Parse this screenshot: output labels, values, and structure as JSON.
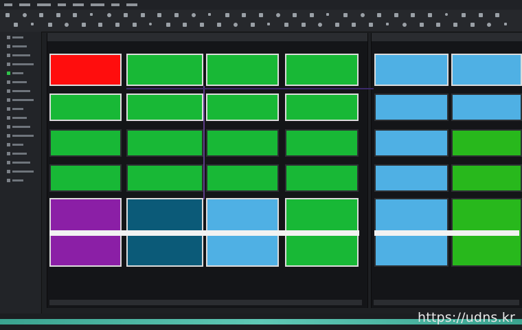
{
  "menu": {
    "items": [
      "",
      "",
      "",
      "",
      "",
      "",
      "",
      ""
    ]
  },
  "sidebar": {
    "items": [
      "",
      "",
      "",
      "",
      "",
      "",
      "",
      "",
      "",
      "",
      "",
      "",
      "",
      "",
      "",
      "",
      ""
    ]
  },
  "grid_colors": {
    "left": [
      [
        "#ff0d0d",
        "#18b836",
        "#18b836",
        "#18b836"
      ],
      [
        "#18b836",
        "#18b836",
        "#18b836",
        "#18b836"
      ],
      [
        "#18b836",
        "#18b836",
        "#18b836",
        "#18b836"
      ],
      [
        "#18b836",
        "#18b836",
        "#18b836",
        "#18b836"
      ],
      [
        "#8b1fa6",
        "#0b5a78",
        "#4fb0e4",
        "#18b836"
      ]
    ],
    "right": [
      [
        "#4fb0e4",
        "#4fb0e4"
      ],
      [
        "#4fb0e4",
        "#4fb0e4"
      ],
      [
        "#4fb0e4",
        "#28b81c"
      ],
      [
        "#4fb0e4",
        "#28b81c"
      ],
      [
        "#4fb0e4",
        "#28b81c"
      ]
    ]
  },
  "watermark": "https://udns.kr"
}
